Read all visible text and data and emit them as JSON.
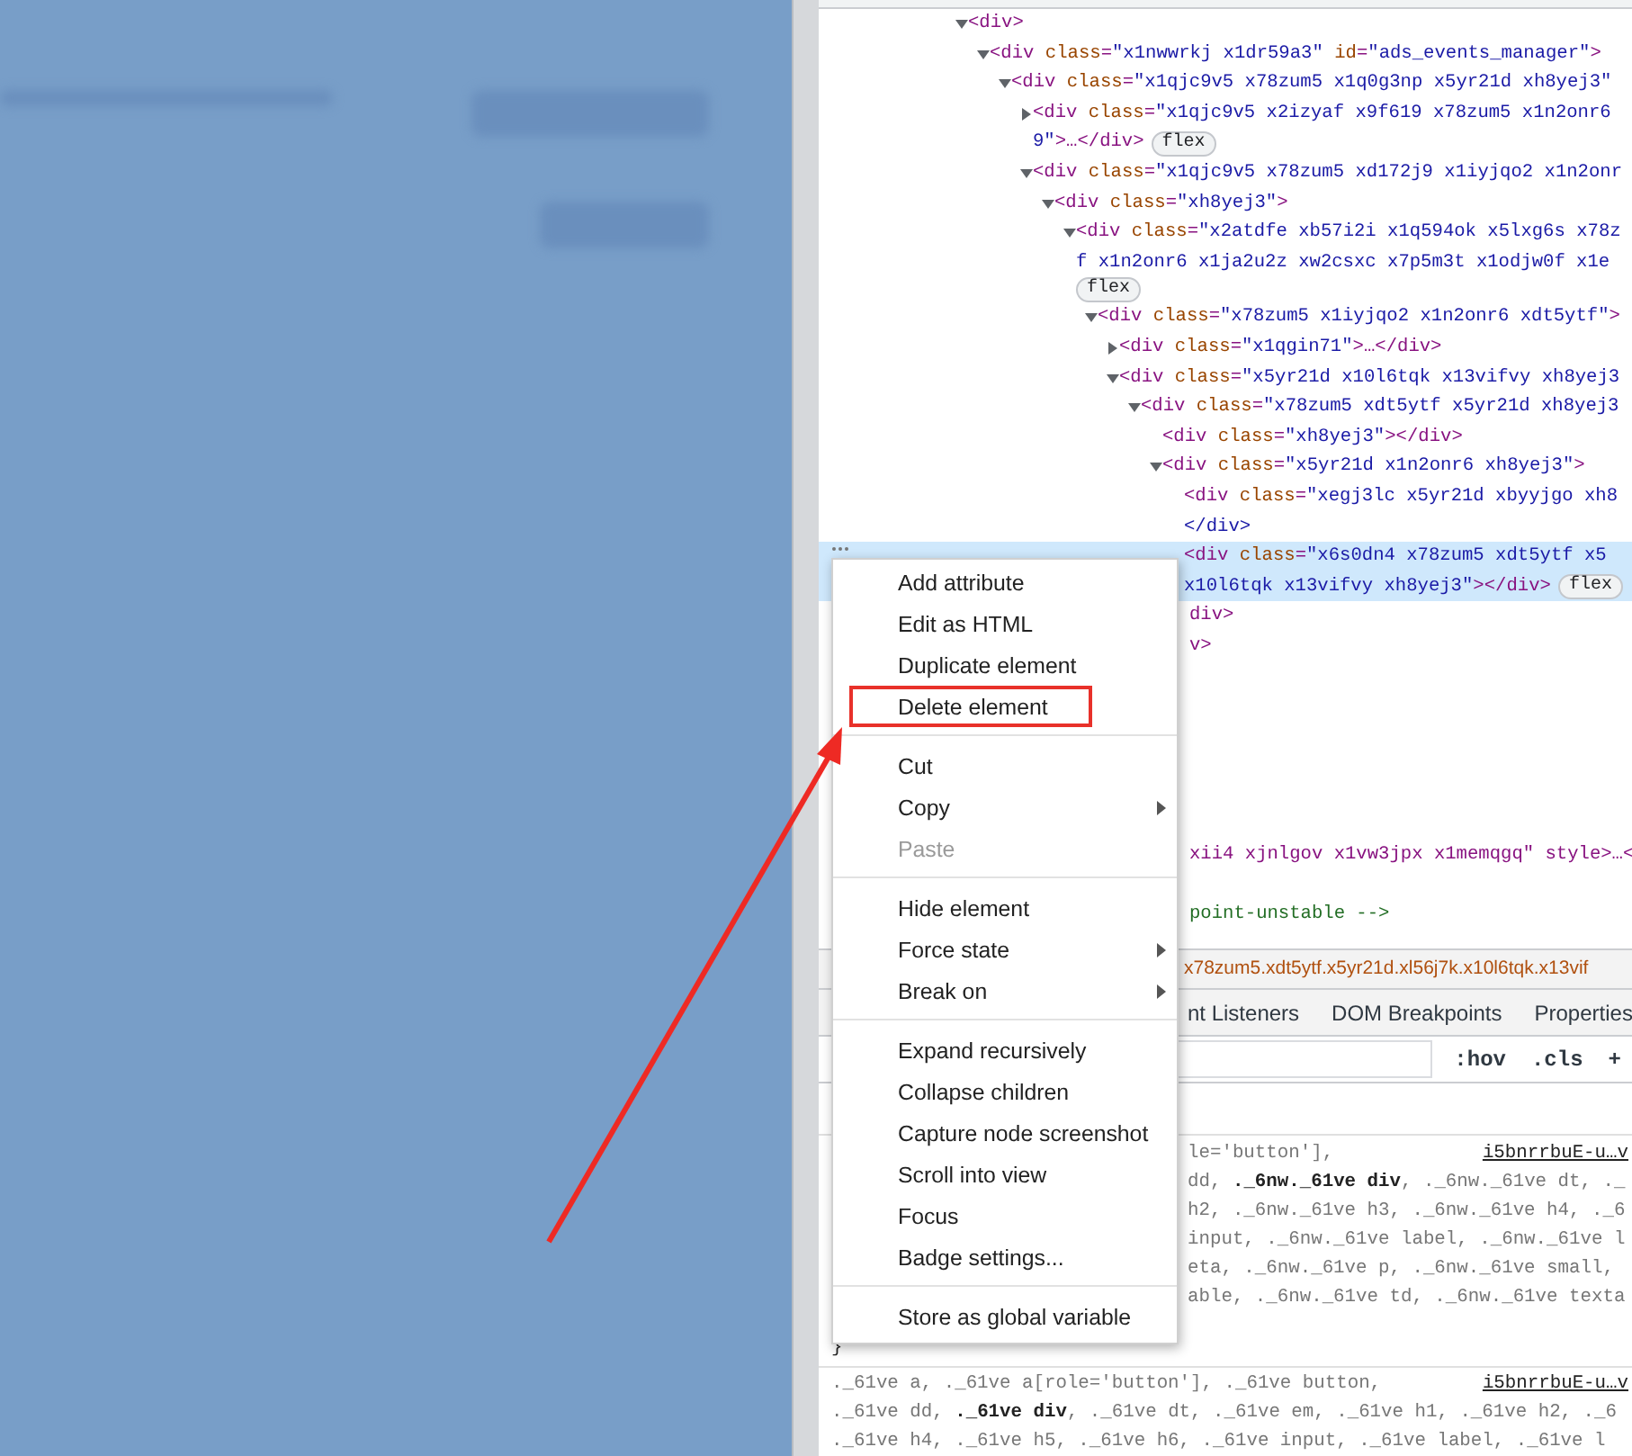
{
  "devtools": {
    "elements_tree": [
      {
        "lines": [
          "<div>"
        ],
        "expanded": true,
        "selected": false,
        "children": [
          {
            "lines": [
              "<div class=\"x1nwwrkj x1dr59a3\" id=\"ads_events_manager\">"
            ],
            "expanded": true,
            "selected": false,
            "children": [
              {
                "lines": [
                  "<div class=\"x1qjc9v5 x78zum5 x1q0g3np x5yr21d xh8yej3\""
                ],
                "expanded": true,
                "selected": false,
                "children": [
                  {
                    "lines": [
                      "<div class=\"x1qjc9v5 x2izyaf x9f619 x78zum5 x1n2onr6",
                      "9\">…</div>"
                    ],
                    "expanded": false,
                    "badge": "flex",
                    "badge_wraps": false,
                    "selected": false
                  },
                  {
                    "lines": [
                      "<div class=\"x1qjc9v5 x78zum5 xd172j9 x1iyjqo2 x1n2onr"
                    ],
                    "expanded": true,
                    "selected": false,
                    "children": [
                      {
                        "lines": [
                          "<div class=\"xh8yej3\">"
                        ],
                        "expanded": true,
                        "selected": false,
                        "children": [
                          {
                            "lines": [
                              "<div class=\"x2atdfe xb57i2i x1q594ok x5lxg6s x78z",
                              "f x1n2onr6 x1ja2u2z xw2csxc x7p5m3t x1odjw0f x1e"
                            ],
                            "expanded": true,
                            "badge": "flex",
                            "badge_wraps": true,
                            "selected": false,
                            "children": [
                              {
                                "lines": [
                                  "<div class=\"x78zum5 x1iyjqo2 x1n2onr6 xdt5ytf\">"
                                ],
                                "expanded": true,
                                "selected": false,
                                "children": [
                                  {
                                    "lines": [
                                      "<div class=\"x1qgin71\">…</div>"
                                    ],
                                    "expanded": false,
                                    "selected": false
                                  },
                                  {
                                    "lines": [
                                      "<div class=\"x5yr21d x10l6tqk x13vifvy xh8yej3"
                                    ],
                                    "expanded": true,
                                    "selected": false,
                                    "children": [
                                      {
                                        "lines": [
                                          "<div class=\"x78zum5 xdt5ytf x5yr21d xh8yej3"
                                        ],
                                        "expanded": true,
                                        "selected": false,
                                        "children": [
                                          {
                                            "lines": [
                                              "<div class=\"xh8yej3\"></div>"
                                            ],
                                            "selected": false
                                          },
                                          {
                                            "lines": [
                                              "<div class=\"x5yr21d x1n2onr6 xh8yej3\">"
                                            ],
                                            "expanded": true,
                                            "selected": false,
                                            "children": [
                                              {
                                                "lines": [
                                                  "<div class=\"xegj3lc x5yr21d xbyyjgo xh8",
                                                  "</div>"
                                                ],
                                                "selected": false
                                              },
                                              {
                                                "lines": [
                                                  "<div class=\"x6s0dn4 x78zum5 xdt5ytf x5",
                                                  "x10l6tqk x13vifvy xh8yej3\"></div>"
                                                ],
                                                "badge": "flex",
                                                "badge_wraps": false,
                                                "selected": true
                                              }
                                            ]
                                          }
                                        ]
                                      }
                                    ]
                                  }
                                ]
                              }
                            ]
                          }
                        ]
                      }
                    ]
                  }
                ]
              }
            ]
          }
        ]
      }
    ],
    "trailing_lines": [
      {
        "kind": "tag",
        "text": "div>"
      },
      {
        "kind": "tag",
        "text": "v>"
      },
      {
        "kind": "blank"
      },
      {
        "kind": "blank"
      },
      {
        "kind": "blank"
      },
      {
        "kind": "blank"
      },
      {
        "kind": "blank"
      },
      {
        "kind": "blank"
      },
      {
        "kind": "tag",
        "text": "xii4 xjnlgov x1vw3jpx x1memqgq\" style>…<"
      },
      {
        "kind": "blank"
      },
      {
        "kind": "comment",
        "text": "point-unstable -->"
      }
    ],
    "breadcrumb": "x78zum5.xdt5ytf.x5yr21d.xl56j7k.x10l6tqk.x13vif",
    "sidebar_tabs": [
      {
        "label": "nt Listeners",
        "selected": false
      },
      {
        "label": "DOM Breakpoints",
        "selected": false
      },
      {
        "label": "Properties",
        "selected": false
      }
    ],
    "filter_buttons": [
      ":hov",
      ".cls",
      "+"
    ],
    "style_rules": [
      {
        "source": "i5bnrrbuE-u…v",
        "offset": true,
        "lines": [
          "le='button'],",
          "dd, **._6nw._61ve div**, ._6nw._61ve dt, ._",
          "h2, ._6nw._61ve h3, ._6nw._61ve h4, ._6",
          "input, ._6nw._61ve label, ._6nw._61ve l",
          "eta, ._6nw._61ve p, ._6nw._61ve small,",
          "able, ._6nw._61ve td, ._6nw._61ve texta"
        ],
        "closing": "}"
      },
      {
        "source": "i5bnrrbuE-u…v",
        "offset": false,
        "lines": [
          "._61ve a, ._61ve a[role='button'], ._61ve button,",
          "._61ve dd, **._61ve div**, ._61ve dt, ._61ve em, ._61ve h1, ._61ve h2, ._6",
          "._61ve h4, ._61ve h5, ._61ve h6, ._61ve input, ._61ve label, ._61ve l"
        ]
      }
    ]
  },
  "context_menu": {
    "groups": [
      [
        {
          "label": "Add attribute",
          "disabled": false,
          "submenu": false,
          "annotated": false
        },
        {
          "label": "Edit as HTML",
          "disabled": false,
          "submenu": false,
          "annotated": false
        },
        {
          "label": "Duplicate element",
          "disabled": false,
          "submenu": false,
          "annotated": false
        },
        {
          "label": "Delete element",
          "disabled": false,
          "submenu": false,
          "annotated": true
        }
      ],
      [
        {
          "label": "Cut",
          "disabled": false,
          "submenu": false,
          "annotated": false
        },
        {
          "label": "Copy",
          "disabled": false,
          "submenu": true,
          "annotated": false
        },
        {
          "label": "Paste",
          "disabled": true,
          "submenu": false,
          "annotated": false
        }
      ],
      [
        {
          "label": "Hide element",
          "disabled": false,
          "submenu": false,
          "annotated": false
        },
        {
          "label": "Force state",
          "disabled": false,
          "submenu": true,
          "annotated": false
        },
        {
          "label": "Break on",
          "disabled": false,
          "submenu": true,
          "annotated": false
        }
      ],
      [
        {
          "label": "Expand recursively",
          "disabled": false,
          "submenu": false,
          "annotated": false
        },
        {
          "label": "Collapse children",
          "disabled": false,
          "submenu": false,
          "annotated": false
        },
        {
          "label": "Capture node screenshot",
          "disabled": false,
          "submenu": false,
          "annotated": false
        },
        {
          "label": "Scroll into view",
          "disabled": false,
          "submenu": false,
          "annotated": false
        },
        {
          "label": "Focus",
          "disabled": false,
          "submenu": false,
          "annotated": false
        },
        {
          "label": "Badge settings...",
          "disabled": false,
          "submenu": false,
          "annotated": false
        }
      ],
      [
        {
          "label": "Store as global variable",
          "disabled": false,
          "submenu": false,
          "annotated": false
        }
      ]
    ]
  }
}
